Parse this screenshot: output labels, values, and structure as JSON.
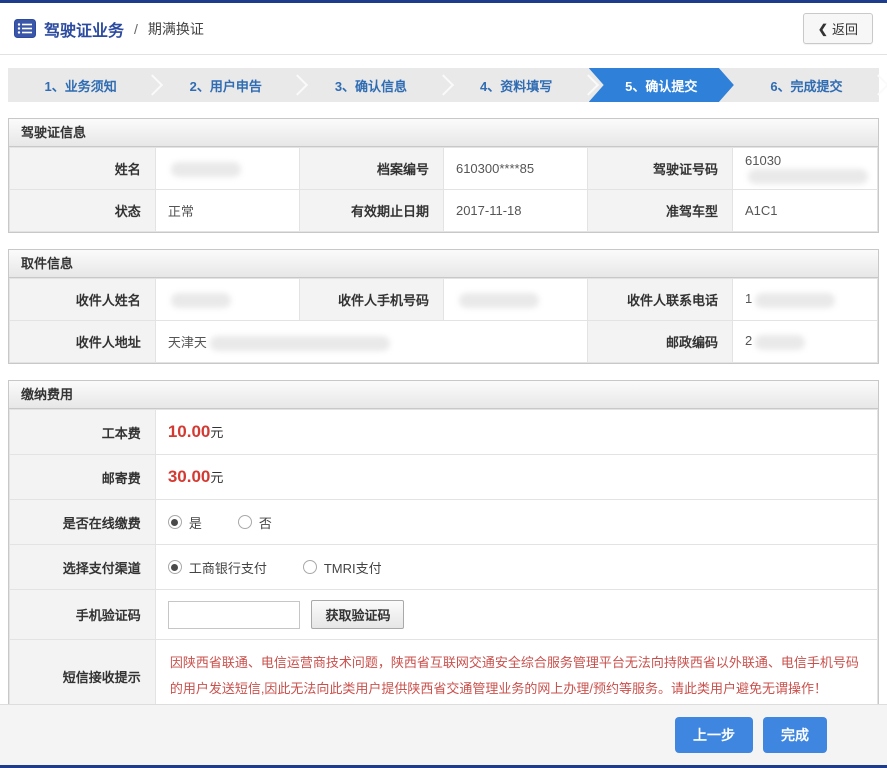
{
  "header": {
    "section_title": "驾驶证业务",
    "separator": "/",
    "page_title": "期满换证",
    "back_button": {
      "icon": "❮",
      "label": "返回"
    }
  },
  "steps": [
    {
      "label": "1、业务须知",
      "active": false
    },
    {
      "label": "2、用户申告",
      "active": false
    },
    {
      "label": "3、确认信息",
      "active": false
    },
    {
      "label": "4、资料填写",
      "active": false
    },
    {
      "label": "5、确认提交",
      "active": true
    },
    {
      "label": "6、完成提交",
      "active": false
    }
  ],
  "license_info": {
    "title": "驾驶证信息",
    "fields": [
      {
        "label": "姓名",
        "value": "",
        "redacted": true
      },
      {
        "label": "档案编号",
        "value": "610300****85",
        "redacted": false
      },
      {
        "label": "驾驶证号码",
        "value": "61030",
        "redacted": true
      },
      {
        "label": "状态",
        "value": "正常",
        "redacted": false
      },
      {
        "label": "有效期止日期",
        "value": "2017-11-18",
        "redacted": false
      },
      {
        "label": "准驾车型",
        "value": "A1C1",
        "redacted": false
      }
    ]
  },
  "pickup_info": {
    "title": "取件信息",
    "fields": [
      {
        "label": "收件人姓名",
        "value": "",
        "redacted": true
      },
      {
        "label": "收件人手机号码",
        "value": "",
        "redacted": true
      },
      {
        "label": "收件人联系电话",
        "value": "1",
        "redacted": true
      },
      {
        "label": "收件人地址",
        "value": "天津天",
        "redacted": true
      },
      {
        "label": "邮政编码",
        "value": "2",
        "redacted": true
      }
    ]
  },
  "payment": {
    "title": "缴纳费用",
    "fees": [
      {
        "label": "工本费",
        "amount": "10.00",
        "unit": "元"
      },
      {
        "label": "邮寄费",
        "amount": "30.00",
        "unit": "元"
      }
    ],
    "online_payment": {
      "label": "是否在线缴费",
      "options": [
        {
          "text": "是",
          "selected": true
        },
        {
          "text": "否",
          "selected": false
        }
      ]
    },
    "channel": {
      "label": "选择支付渠道",
      "options": [
        {
          "text": "工商银行支付",
          "selected": true
        },
        {
          "text": "TMRI支付",
          "selected": false
        }
      ]
    },
    "sms_code": {
      "label": "手机验证码",
      "input_value": "",
      "button_label": "获取验证码"
    },
    "sms_notice": {
      "label": "短信接收提示",
      "text": "因陕西省联通、电信运营商技术问题，陕西省互联网交通安全综合服务管理平台无法向持陕西省以外联通、电信手机号码的用户发送短信,因此无法向此类用户提供陕西省交通管理业务的网上办理/预约等服务。请此类用户避免无谓操作！"
    }
  },
  "footer": {
    "prev_button": "上一步",
    "finish_button": "完成"
  },
  "colors": {
    "top_bar": "#1e3c8c",
    "active_step": "#2e80d9",
    "step_text": "#2f6cb3",
    "title_blue": "#2c4ba0",
    "fee_red": "#d33a32",
    "notice_red": "#c9504c",
    "action_button_blue": "#3f86e0"
  }
}
